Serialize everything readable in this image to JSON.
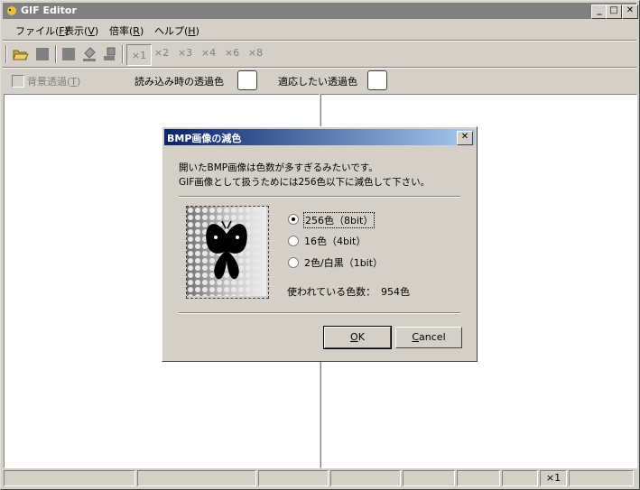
{
  "window": {
    "title": "GIF Editor"
  },
  "menu": [
    {
      "label": "ファイル(",
      "mn": "F",
      "end": ")"
    },
    {
      "label": "表示(",
      "mn": "V",
      "end": ")"
    },
    {
      "label": "倍率(",
      "mn": "R",
      "end": ")"
    },
    {
      "label": "ヘルプ(",
      "mn": "H",
      "end": ")"
    }
  ],
  "toolbar": {
    "zoom": [
      "×1",
      "×2",
      "×3",
      "×4",
      "×6",
      "×8"
    ]
  },
  "options": {
    "bg_transparent": "背景透過(",
    "bg_transparent_mn": "T",
    "bg_transparent_end": ")",
    "load_color_label": "読み込み時の透過色",
    "target_color_label": "適応したい透過色"
  },
  "status": {
    "zoom": "×1"
  },
  "dialog": {
    "title": "BMP画像の減色",
    "message1": "開いたBMP画像は色数が多すぎるみたいです。",
    "message2": "GIF画像として扱うためには256色以下に減色して下さい。",
    "options": [
      "256色（8bit）",
      "16色（4bit）",
      "2色/白黒（1bit）"
    ],
    "selected": 0,
    "colors_used_label": "使われている色数：",
    "colors_used_value": "954色",
    "ok": "OK",
    "ok_mn": "O",
    "cancel": "Cancel",
    "cancel_mn": "C"
  }
}
